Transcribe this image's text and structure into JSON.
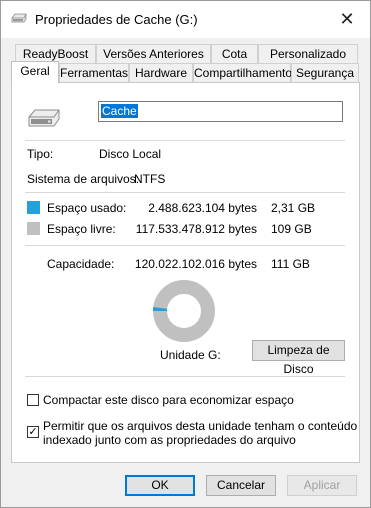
{
  "window": {
    "title": "Propriedades de Cache (G:)"
  },
  "tabs": {
    "row1": [
      "ReadyBoost",
      "Versões Anteriores",
      "Cota",
      "Personalizado"
    ],
    "row2": [
      "Geral",
      "Ferramentas",
      "Hardware",
      "Compartilhamento",
      "Segurança"
    ],
    "active": "Geral"
  },
  "general": {
    "drive_name_value": "Cache",
    "type_label": "Tipo:",
    "type_value": "Disco Local",
    "fs_label": "Sistema de arquivos:",
    "fs_value": "NTFS",
    "used_label": "Espaço usado:",
    "used_bytes": "2.488.623.104 bytes",
    "used_size": "2,31 GB",
    "free_label": "Espaço livre:",
    "free_bytes": "117.533.478.912 bytes",
    "free_size": "109 GB",
    "capacity_label": "Capacidade:",
    "capacity_bytes": "120.022.102.016 bytes",
    "capacity_size": "111 GB",
    "drive_caption": "Unidade G:",
    "used_fraction": 0.0207,
    "used_color": "#26a0da",
    "free_color": "#c0c0c0",
    "cleanup_button": "Limpeza de Disco",
    "compress_label": "Compactar este disco para economizar espaço",
    "compress_checked": false,
    "index_label_line1": "Permitir que os arquivos desta unidade tenham o conteúdo",
    "index_label_line2": "indexado junto com as propriedades do arquivo",
    "index_checked": true
  },
  "footer": {
    "ok": "OK",
    "cancel": "Cancelar",
    "apply": "Aplicar"
  }
}
